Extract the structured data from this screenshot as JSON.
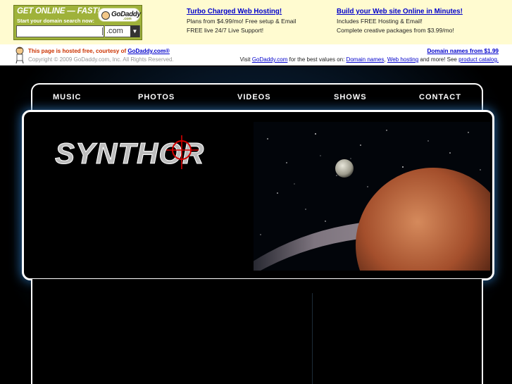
{
  "godaddy": {
    "ad": {
      "title": "GET ONLINE — FAST!",
      "subtitle": "Start your domain search now:",
      "logo_text": "GoDaddy",
      "logo_tld": ".com",
      "search_value": "",
      "domain_suffix": ".com",
      "tld_arrow": "▼"
    },
    "col1": {
      "heading": "Turbo Charged Web Hosting!",
      "line1": "Plans from $4.99/mo! Free setup & Email",
      "line2": "FREE live 24/7 Live Support!"
    },
    "col2": {
      "heading": "Build your Web site Online in Minutes!",
      "line1": "Includes FREE Hosting & Email!",
      "line2": "Complete creative packages from $3.99/mo!"
    },
    "info": {
      "hosted_prefix": "This page is hosted free, courtesy of ",
      "hosted_link": "GoDaddy.com®",
      "copyright": "Copyright © 2009 GoDaddy.com, Inc. All Rights Reserved.",
      "domain_names_link": "Domain names from $1.99",
      "visit_prefix": "Visit ",
      "visit_link": "GoDaddy.com",
      "visit_middle": " for the best values on: ",
      "link_domains": "Domain names",
      "comma": ", ",
      "link_hosting": "Web hosting",
      "visit_suffix": " and more! See ",
      "link_catalog": "product catalog."
    }
  },
  "site": {
    "logo": "SYNTHOR",
    "nav": [
      "MUSIC",
      "PHOTOS",
      "VIDEOS",
      "SHOWS",
      "CONTACT"
    ]
  },
  "colors": {
    "banner_bg": "#fffbd0",
    "ad_green": "#9fb23a",
    "link_blue": "#0000cc",
    "hosted_orange": "#cc3300",
    "site_bg": "#000000",
    "glow_blue": "#2a6fb0",
    "crosshair_red": "#d40000"
  }
}
